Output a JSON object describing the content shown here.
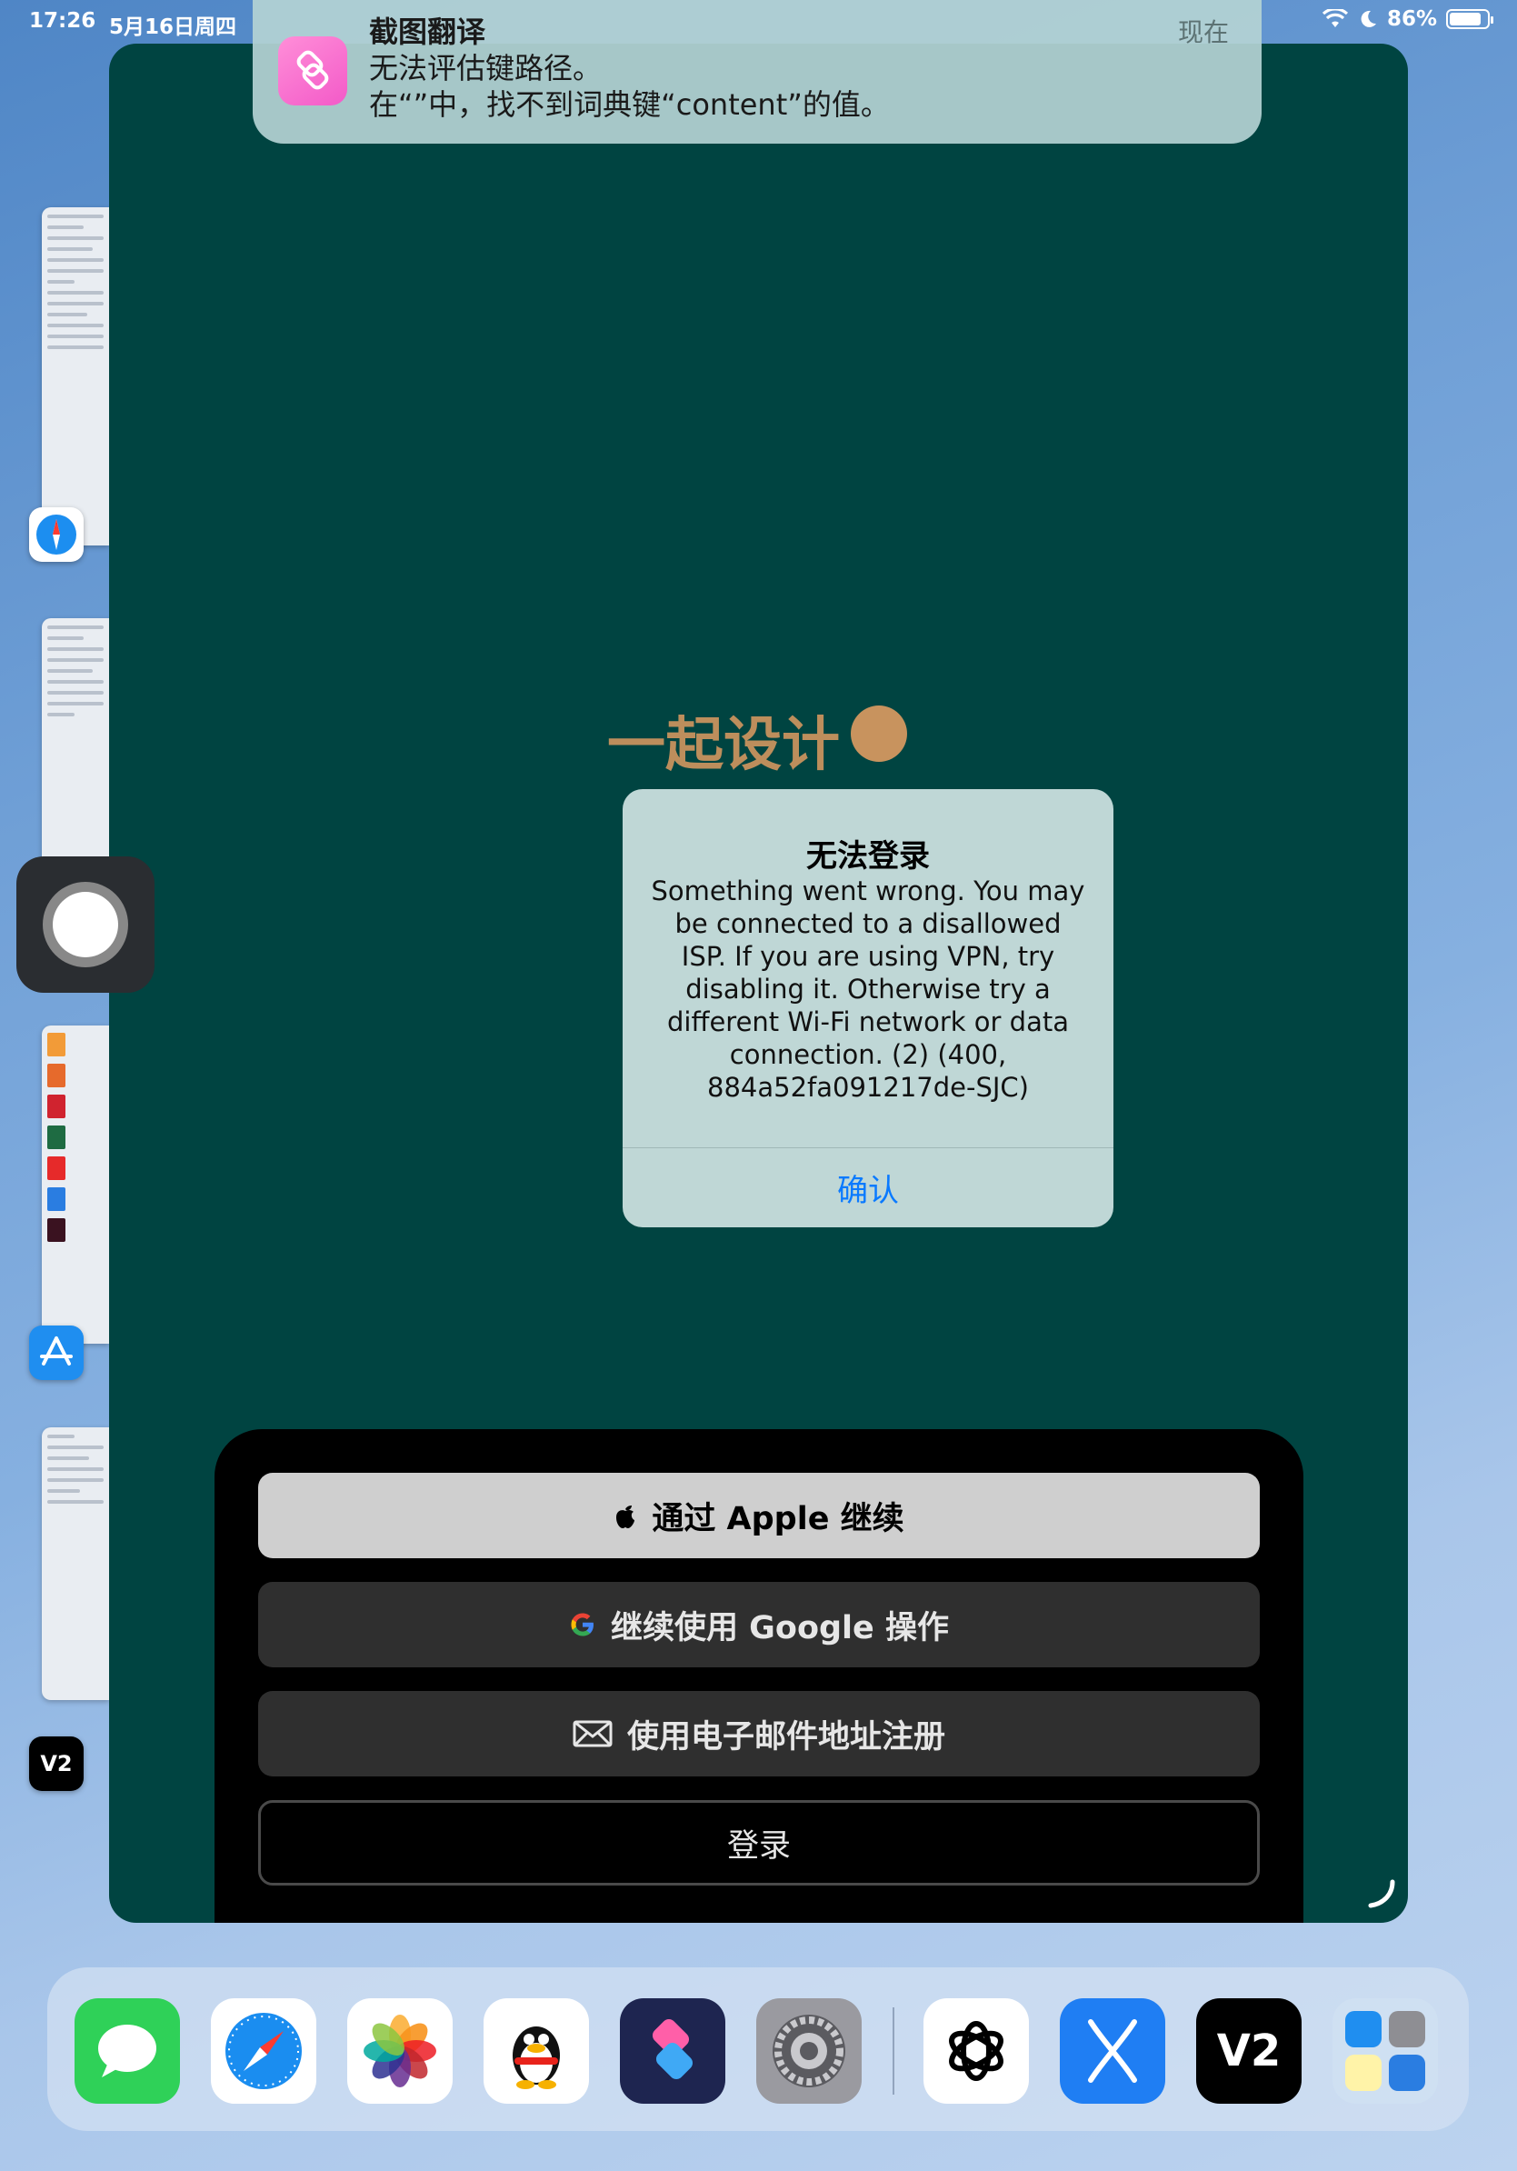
{
  "status_bar": {
    "time": "17:26",
    "date": "5月16日周四",
    "battery": "86%",
    "battery_level": 0.86
  },
  "notification": {
    "app": "截图翻译",
    "line1": "无法评估键路径。",
    "line2": "在“”中，找不到词典键“content”的值。",
    "time": "现在"
  },
  "app": {
    "brand": "一起设计"
  },
  "alert": {
    "title": "无法登录",
    "message": "Something went wrong. You may be connected to a disallowed ISP. If you are using VPN, try disabling it. Otherwise try a different Wi-Fi network or data connection. (2) (400, 884a52fa091217de-SJC)",
    "confirm": "确认"
  },
  "auth": {
    "apple": "通过 Apple 继续",
    "google": "继续使用 Google 操作",
    "email": "使用电子邮件地址注册",
    "login": "登录"
  },
  "dock": [
    {
      "name": "messages",
      "color": "#2fd158"
    },
    {
      "name": "safari",
      "color": "#ffffff"
    },
    {
      "name": "photos",
      "color": "#ffffff"
    },
    {
      "name": "qq",
      "color": "#ffffff"
    },
    {
      "name": "shortcuts",
      "color": "#2b2f6b"
    },
    {
      "name": "settings",
      "color": "#8e8e93"
    },
    {
      "name": "chatgpt",
      "color": "#ffffff"
    },
    {
      "name": "x-app",
      "color": "#1f7ef3"
    },
    {
      "name": "v2box",
      "color": "#000000"
    },
    {
      "name": "app-library",
      "color": "#cfe0f2"
    }
  ]
}
